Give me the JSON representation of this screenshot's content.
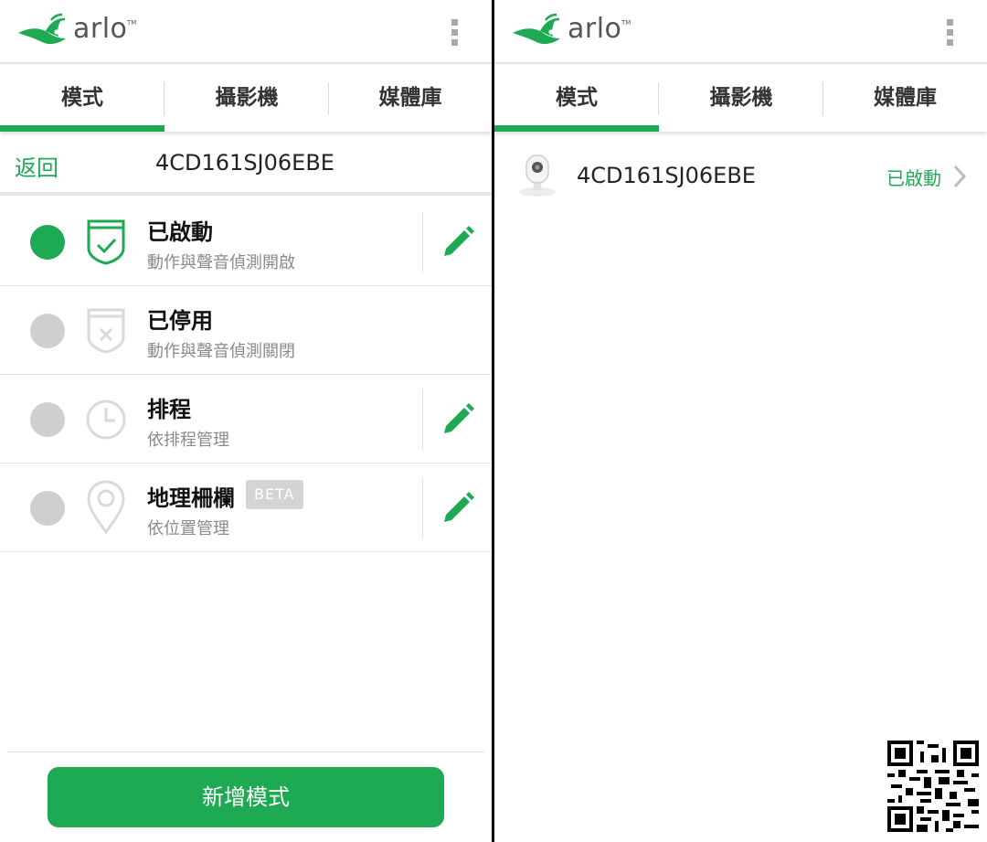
{
  "brand": {
    "logo_text": "arlo",
    "tm": "TM",
    "accent_color": "#1eaa52"
  },
  "tabs": [
    "模式",
    "攝影機",
    "媒體庫"
  ],
  "left": {
    "back_label": "返回",
    "device_title": "4CD161SJ06EBE",
    "modes": [
      {
        "title": "已啟動",
        "desc": "動作與聲音偵測開啟",
        "selected": true,
        "icon": "shield-check-icon",
        "editable": true
      },
      {
        "title": "已停用",
        "desc": "動作與聲音偵測關閉",
        "selected": false,
        "icon": "shield-x-icon",
        "editable": false
      },
      {
        "title": "排程",
        "desc": "依排程管理",
        "selected": false,
        "icon": "clock-icon",
        "editable": true
      },
      {
        "title": "地理柵欄",
        "desc": "依位置管理",
        "selected": false,
        "icon": "location-pin-icon",
        "editable": true,
        "badge": "BETA"
      }
    ],
    "add_mode_label": "新增模式"
  },
  "right": {
    "camera": {
      "name": "4CD161SJ06EBE",
      "status": "已啟動",
      "icon": "camera-thumbnail"
    }
  }
}
